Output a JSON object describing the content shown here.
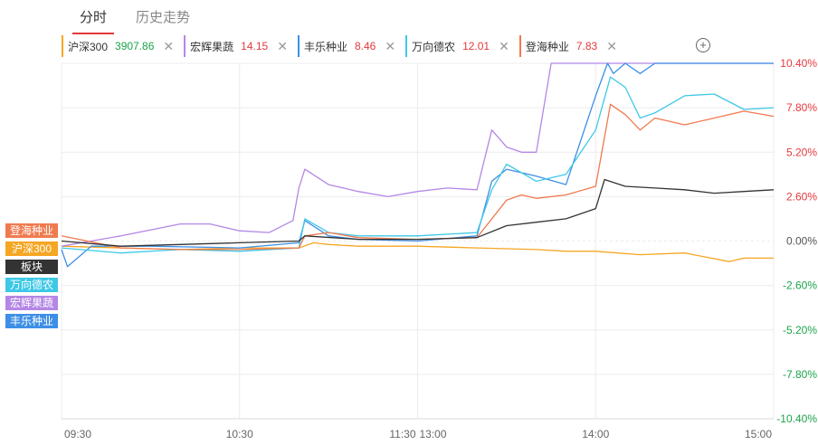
{
  "tabs": [
    {
      "label": "分时",
      "active": true
    },
    {
      "label": "历史走势",
      "active": false
    }
  ],
  "chips": [
    {
      "name": "沪深300",
      "value": "3907.86",
      "color": "#f5a623",
      "value_color": "#1ca34a"
    },
    {
      "name": "宏辉果蔬",
      "value": "14.15",
      "color": "#b487e6",
      "value_color": "#e4393c"
    },
    {
      "name": "丰乐种业",
      "value": "8.46",
      "color": "#3d8fe6",
      "value_color": "#e4393c"
    },
    {
      "name": "万向德农",
      "value": "12.01",
      "color": "#3ec8e6",
      "value_color": "#e4393c"
    },
    {
      "name": "登海种业",
      "value": "7.83",
      "color": "#f07a4f",
      "value_color": "#e4393c"
    }
  ],
  "close_symbol": "✕",
  "add_symbol": "+",
  "legend": [
    {
      "label": "登海种业",
      "color": "#f07a4f"
    },
    {
      "label": "沪深300",
      "color": "#f5a623"
    },
    {
      "label": "板块",
      "color": "#333333"
    },
    {
      "label": "万向德农",
      "color": "#3ec8e6"
    },
    {
      "label": "宏辉果蔬",
      "color": "#b487e6"
    },
    {
      "label": "丰乐种业",
      "color": "#3d8fe6"
    }
  ],
  "chart_data": {
    "type": "line",
    "y_unit": "%",
    "ylim": [
      -10.4,
      10.4
    ],
    "y_ticks": [
      "10.40%",
      "7.80%",
      "5.20%",
      "2.60%",
      "0.00%",
      "-2.60%",
      "-5.20%",
      "-7.80%",
      "-10.40%"
    ],
    "y_tick_values": [
      10.4,
      7.8,
      5.2,
      2.6,
      0,
      -2.6,
      -5.2,
      -7.8,
      -10.4
    ],
    "x_ticks": [
      "09:30",
      "10:30",
      "11:30",
      "13:00",
      "14:00",
      "15:00"
    ],
    "x_tick_positions": [
      0,
      60,
      120,
      120,
      180,
      240
    ],
    "x_range": [
      0,
      240
    ],
    "grid": true,
    "up_color": "#e4393c",
    "down_color": "#1ca34a",
    "flat_color": "#555555",
    "series": [
      {
        "name": "沪深300",
        "color": "#f5a623",
        "x": [
          0,
          20,
          40,
          60,
          80,
          85,
          90,
          100,
          120,
          140,
          160,
          170,
          180,
          195,
          210,
          225,
          230,
          240
        ],
        "y": [
          -0.3,
          -0.4,
          -0.5,
          -0.4,
          -0.4,
          -0.1,
          -0.2,
          -0.3,
          -0.3,
          -0.4,
          -0.5,
          -0.6,
          -0.6,
          -0.8,
          -0.7,
          -1.2,
          -1.0,
          -1.0
        ]
      },
      {
        "name": "宏辉果蔬",
        "color": "#b487e6",
        "x": [
          0,
          20,
          40,
          50,
          60,
          70,
          78,
          80,
          82,
          90,
          100,
          110,
          120,
          130,
          140,
          145,
          150,
          155,
          160,
          165,
          170,
          240
        ],
        "y": [
          -0.3,
          0.3,
          1.0,
          1.0,
          0.6,
          0.5,
          1.2,
          3.1,
          4.2,
          3.3,
          2.9,
          2.6,
          2.9,
          3.1,
          3.0,
          6.5,
          5.5,
          5.2,
          5.2,
          10.4,
          10.4,
          10.4
        ]
      },
      {
        "name": "丰乐种业",
        "color": "#3d8fe6",
        "x": [
          0,
          2,
          10,
          30,
          60,
          80,
          82,
          90,
          100,
          120,
          140,
          145,
          150,
          160,
          170,
          180,
          184,
          186,
          190,
          195,
          200,
          240
        ],
        "y": [
          -0.5,
          -1.5,
          -0.3,
          -0.3,
          -0.4,
          -0.1,
          1.2,
          0.3,
          0.1,
          0.0,
          0.3,
          3.5,
          4.2,
          3.8,
          3.3,
          8.5,
          10.4,
          9.8,
          10.4,
          9.8,
          10.4,
          10.4
        ]
      },
      {
        "name": "万向德农",
        "color": "#3ec8e6",
        "x": [
          0,
          20,
          40,
          60,
          80,
          82,
          90,
          100,
          120,
          140,
          145,
          150,
          155,
          160,
          170,
          180,
          185,
          190,
          195,
          200,
          210,
          220,
          230,
          240
        ],
        "y": [
          -0.4,
          -0.7,
          -0.5,
          -0.6,
          -0.4,
          1.3,
          0.5,
          0.3,
          0.3,
          0.5,
          3.0,
          4.5,
          4.0,
          3.5,
          3.9,
          6.5,
          9.6,
          9.0,
          7.2,
          7.5,
          8.5,
          8.6,
          7.7,
          7.8
        ]
      },
      {
        "name": "登海种业",
        "color": "#f07a4f",
        "x": [
          0,
          20,
          40,
          60,
          80,
          82,
          90,
          100,
          120,
          140,
          150,
          155,
          160,
          170,
          180,
          185,
          190,
          195,
          200,
          210,
          220,
          230,
          240
        ],
        "y": [
          0.3,
          -0.4,
          -0.5,
          -0.5,
          -0.4,
          0.3,
          0.5,
          0.2,
          0.1,
          0.2,
          2.4,
          2.7,
          2.5,
          2.7,
          3.2,
          8.0,
          7.4,
          6.5,
          7.2,
          6.8,
          7.2,
          7.6,
          7.3
        ]
      },
      {
        "name": "板块",
        "color": "#333333",
        "x": [
          0,
          20,
          40,
          60,
          80,
          82,
          100,
          120,
          140,
          150,
          160,
          170,
          180,
          183,
          190,
          200,
          210,
          220,
          230,
          240
        ],
        "y": [
          0.0,
          -0.3,
          -0.2,
          -0.1,
          0.0,
          0.3,
          0.1,
          0.1,
          0.2,
          0.9,
          1.1,
          1.3,
          1.9,
          3.6,
          3.2,
          3.1,
          3.0,
          2.8,
          2.9,
          3.0
        ]
      }
    ]
  }
}
